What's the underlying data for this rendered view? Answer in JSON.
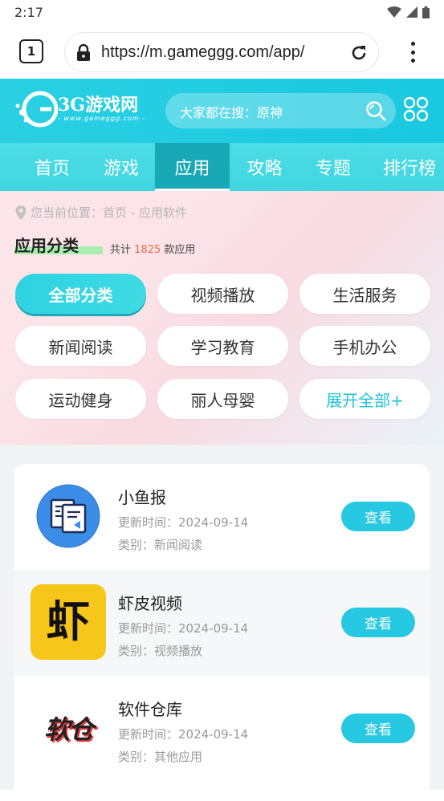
{
  "status": {
    "time": "2:17"
  },
  "browser": {
    "tab_count": "1",
    "url": "https://m.gameggg.com/app/"
  },
  "site": {
    "logo_title": "3G游戏网",
    "logo_sub": "- www.gameggg.com -",
    "search_placeholder": "大家都在搜：原神",
    "brand_color": "#19c8e0"
  },
  "nav": {
    "items": [
      {
        "label": "首页"
      },
      {
        "label": "游戏"
      },
      {
        "label": "应用"
      },
      {
        "label": "攻略"
      },
      {
        "label": "专题"
      },
      {
        "label": "排行榜"
      }
    ],
    "active_index": 2
  },
  "category": {
    "breadcrumb": "您当前位置：首页 - 应用软件",
    "title": "应用分类",
    "count_prefix": "共计",
    "count": "1825",
    "count_suffix": "款应用",
    "chips": [
      {
        "label": "全部分类"
      },
      {
        "label": "视频播放"
      },
      {
        "label": "生活服务"
      },
      {
        "label": "新闻阅读"
      },
      {
        "label": "学习教育"
      },
      {
        "label": "手机办公"
      },
      {
        "label": "运动健身"
      },
      {
        "label": "丽人母婴"
      },
      {
        "label": "展开全部+"
      }
    ]
  },
  "apps": [
    {
      "name": "小鱼报",
      "date": "更新时间：2024-09-14",
      "category": "类别：新闻阅读",
      "button": "查看",
      "icon": "newspaper-icon"
    },
    {
      "name": "虾皮视频",
      "date": "更新时间：2024-09-14",
      "category": "类别：视频播放",
      "button": "查看",
      "icon": "shrimp-video-icon",
      "icon_glyph": "虾"
    },
    {
      "name": "软件仓库",
      "date": "更新时间：2024-09-14",
      "category": "类别：其他应用",
      "button": "查看",
      "icon": "software-warehouse-icon",
      "icon_glyph": "软仓"
    }
  ]
}
